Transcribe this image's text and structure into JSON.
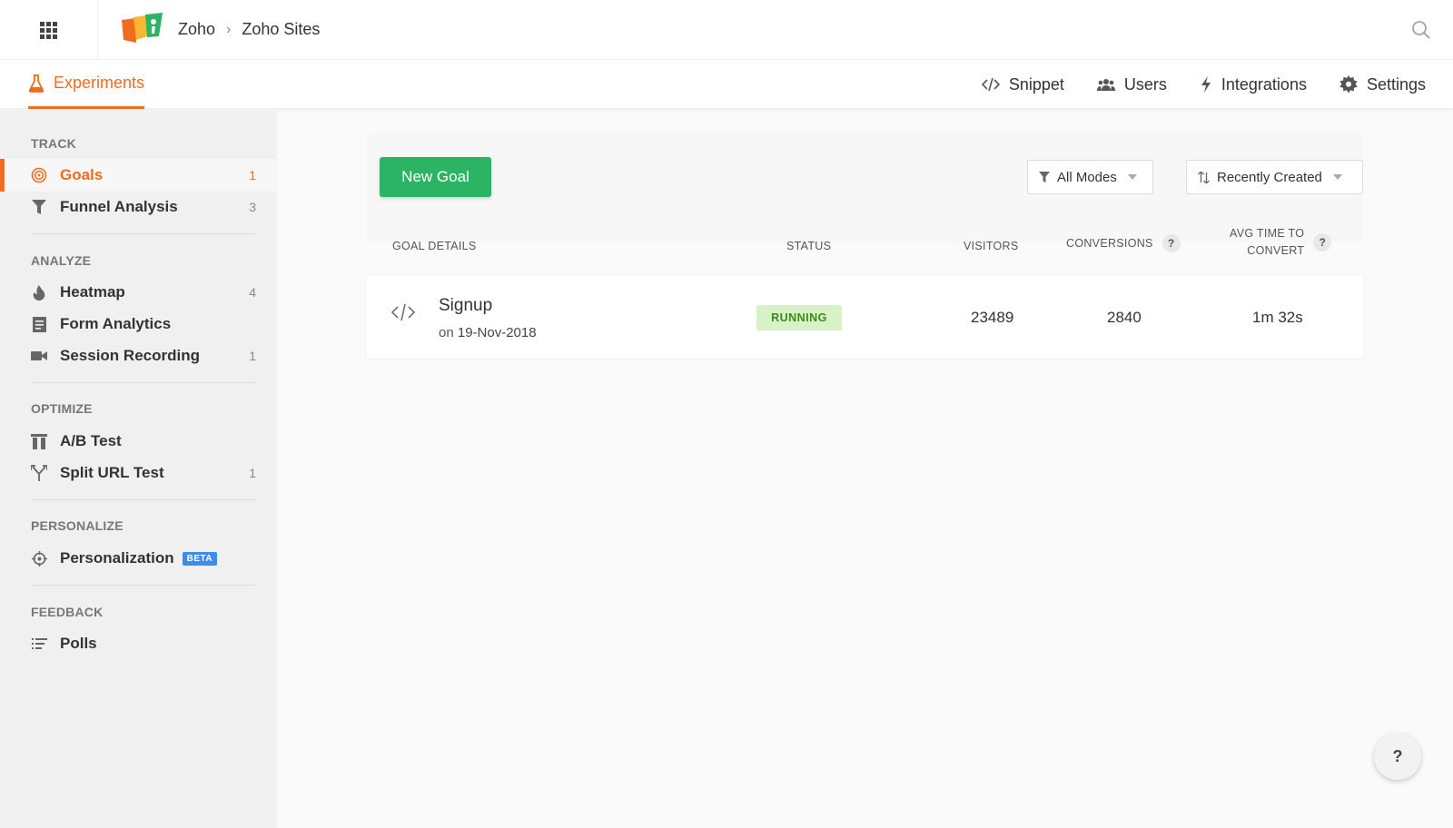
{
  "header": {
    "breadcrumb": [
      "Zoho",
      "Zoho Sites"
    ],
    "breadcrumb_separator": "›"
  },
  "nav": {
    "active_tab": "Experiments",
    "items": [
      "Snippet",
      "Users",
      "Integrations",
      "Settings"
    ]
  },
  "sidebar": {
    "sections": [
      {
        "title": "TRACK",
        "items": [
          {
            "label": "Goals",
            "count": "1",
            "icon": "target-icon",
            "active": true
          },
          {
            "label": "Funnel Analysis",
            "count": "3",
            "icon": "funnel-icon"
          }
        ]
      },
      {
        "title": "ANALYZE",
        "items": [
          {
            "label": "Heatmap",
            "count": "4",
            "icon": "flame-icon"
          },
          {
            "label": "Form Analytics",
            "count": "",
            "icon": "form-icon"
          },
          {
            "label": "Session Recording",
            "count": "1",
            "icon": "video-camera-icon"
          }
        ]
      },
      {
        "title": "OPTIMIZE",
        "items": [
          {
            "label": "A/B Test",
            "count": "",
            "icon": "ab-test-icon"
          },
          {
            "label": "Split URL Test",
            "count": "1",
            "icon": "split-arrow-icon"
          }
        ]
      },
      {
        "title": "PERSONALIZE",
        "items": [
          {
            "label": "Personalization",
            "count": "",
            "icon": "crosshair-icon",
            "badge": "BETA"
          }
        ]
      },
      {
        "title": "FEEDBACK",
        "items": [
          {
            "label": "Polls",
            "count": "",
            "icon": "list-icon"
          }
        ]
      }
    ]
  },
  "toolbar": {
    "new_goal_label": "New Goal",
    "mode_filter": "All Modes",
    "sort": "Recently Created"
  },
  "table": {
    "headers": {
      "details": "GOAL DETAILS",
      "status": "STATUS",
      "visitors": "VISITORS",
      "conversions": "CONVERSIONS",
      "avg_time_line1": "AVG TIME TO",
      "avg_time_line2": "CONVERT"
    },
    "rows": [
      {
        "name": "Signup",
        "date_prefix": "on",
        "date": "19-Nov-2018",
        "status": "RUNNING",
        "visitors": "23489",
        "conversions": "2840",
        "avg_time": "1m 32s"
      }
    ]
  },
  "help": {
    "label": "?"
  },
  "colors": {
    "accent": "#f26b21",
    "primary_button": "#2ab463",
    "status_running_bg": "#d8f2c7",
    "beta": "#3d8ee8"
  }
}
